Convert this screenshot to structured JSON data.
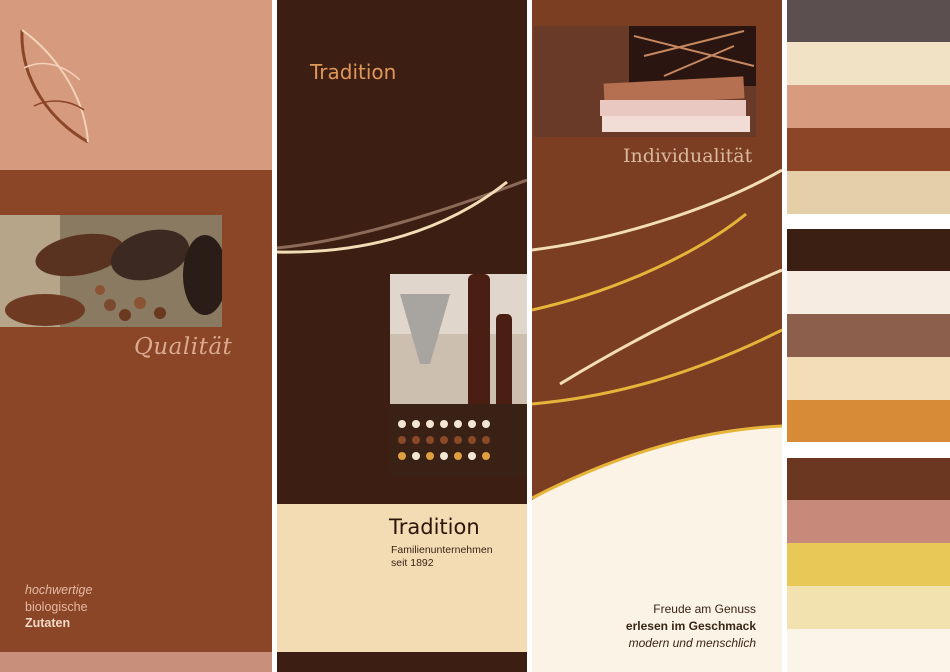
{
  "panel_qualitaet": {
    "heading": "Qualität",
    "tagline_1": "hochwertige",
    "tagline_2": "biologische",
    "tagline_3": "Zutaten"
  },
  "panel_tradition": {
    "heading": "Tradition",
    "title": "Tradition",
    "subtitle_1": "Familienunternehmen",
    "subtitle_2": "seit 1892"
  },
  "panel_individualitaet": {
    "heading": "Individualität",
    "line_1": "Freude am Genuss",
    "line_2": "erlesen im Geschmack",
    "line_3": "modern und menschlich"
  },
  "palette": {
    "group_1": [
      "#5b4f50",
      "#f1e2c6",
      "#d79b80",
      "#8c4527",
      "#e4cfa8"
    ],
    "group_2": [
      "#3c1f13",
      "#f6ece2",
      "#8c5f4c",
      "#f3ddb6",
      "#d88b36"
    ],
    "group_3": [
      "#6b3720",
      "#c6897a",
      "#e8c857",
      "#f1e2b0",
      "#fbf5e9"
    ]
  }
}
